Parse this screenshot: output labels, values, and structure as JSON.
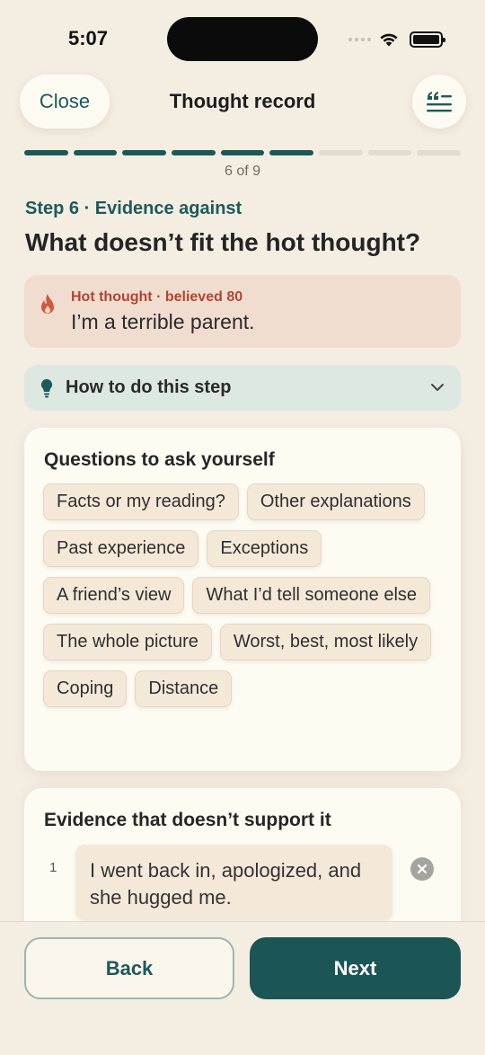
{
  "status_bar": {
    "time": "5:07"
  },
  "header": {
    "close_label": "Close",
    "title": "Thought record",
    "quote_icon": "quote-list-icon"
  },
  "progress": {
    "current": 6,
    "total": 9,
    "label": "6 of 9"
  },
  "step": {
    "label": "Step 6 · Evidence against",
    "question": "What doesn’t fit the hot thought?"
  },
  "hot_thought": {
    "meta": "Hot thought · believed 80",
    "text": "I’m a terrible parent.",
    "icon": "flame-icon"
  },
  "how_to": {
    "label": "How to do this step",
    "icon": "lightbulb-icon"
  },
  "questions": {
    "title": "Questions to ask yourself",
    "chips": [
      "Facts or my reading?",
      "Other explanations",
      "Past experience",
      "Exceptions",
      "A friend’s view",
      "What I’d tell someone else",
      "The whole picture",
      "Worst, best, most likely",
      "Coping",
      "Distance"
    ]
  },
  "evidence": {
    "title": "Evidence that doesn’t support it",
    "items": [
      {
        "number": "1",
        "text": "I went back in, apologized, and she hugged me."
      }
    ]
  },
  "footer": {
    "back_label": "Back",
    "next_label": "Next"
  },
  "colors": {
    "accent": "#1b5555",
    "background": "#f4ede2",
    "hot_thought_bg": "#f1ddd0",
    "hot_thought_text": "#b04530",
    "howto_bg": "#dde8e3"
  }
}
